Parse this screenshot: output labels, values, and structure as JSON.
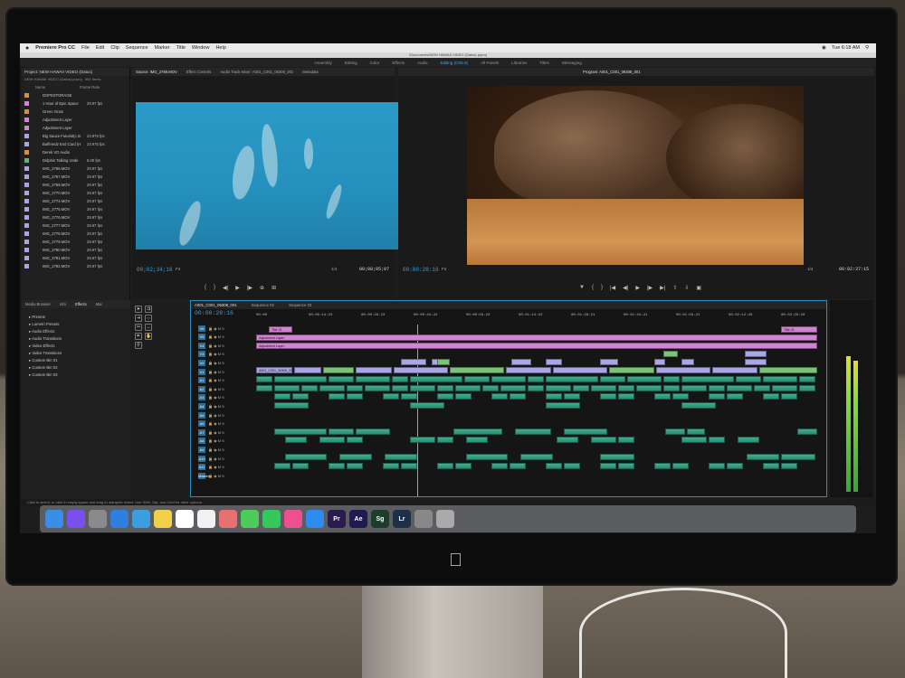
{
  "menubar": {
    "app_name": "Premiere Pro CC",
    "items": [
      "File",
      "Edit",
      "Clip",
      "Sequence",
      "Marker",
      "Title",
      "Window",
      "Help"
    ],
    "clock": "Tue 6:18 AM"
  },
  "window_title": "/Documents/NEW HAWAII VIDEO (Datus).prproj",
  "workspaces": [
    "Assembly",
    "Editing",
    "Color",
    "Effects",
    "Audio",
    "Editing (CS5.5)",
    "All Panels",
    "Libraries",
    "Titles",
    "Messaging"
  ],
  "workspaces_active": "Editing (CS5.5)",
  "project": {
    "tab": "Project: NEW HAWAII VIDEO (Datus)",
    "path": "NEW HAWAII VIDEO (Datus).prproj",
    "items_count": "563 Items",
    "col_name": "Name",
    "col_fps": "Frame Rate",
    "rows": [
      {
        "name": "DOPESTORAGE",
        "fps": "",
        "color": "#e08a3a"
      },
      {
        "name": "1 Hour of Epic Space",
        "fps": "29.97 fps",
        "color": "#d283d3"
      },
      {
        "name": "Green Grain",
        "fps": "",
        "color": "#e08a3a"
      },
      {
        "name": "Adjustment Layer",
        "fps": "",
        "color": "#d283d3"
      },
      {
        "name": "Adjustment Layer",
        "fps": "",
        "color": "#d283d3"
      },
      {
        "name": "Big Sauce Futurist(c.m",
        "fps": "23.976 fps",
        "color": "#a9a6e6"
      },
      {
        "name": "Bufferedz End Card (H",
        "fps": "23.976 fps",
        "color": "#a9a6e6"
      },
      {
        "name": "Derek VO Audio",
        "fps": "",
        "color": "#e08a3a"
      },
      {
        "name": "Dolphin Talking Unde",
        "fps": "6.00 fps",
        "color": "#5ab96c"
      },
      {
        "name": "IMG_2766.MOV",
        "fps": "29.97 fps",
        "color": "#a9a6e6"
      },
      {
        "name": "IMG_2767.MOV",
        "fps": "29.97 fps",
        "color": "#a9a6e6"
      },
      {
        "name": "IMG_2769.MOV",
        "fps": "29.97 fps",
        "color": "#a9a6e6"
      },
      {
        "name": "IMG_2770.MOV",
        "fps": "29.97 fps",
        "color": "#a9a6e6"
      },
      {
        "name": "IMG_2774.MOV",
        "fps": "29.97 fps",
        "color": "#a9a6e6"
      },
      {
        "name": "IMG_2775.MOV",
        "fps": "29.97 fps",
        "color": "#a9a6e6"
      },
      {
        "name": "IMG_2776.MOV",
        "fps": "29.97 fps",
        "color": "#a9a6e6"
      },
      {
        "name": "IMG_2777.MOV",
        "fps": "29.97 fps",
        "color": "#a9a6e6"
      },
      {
        "name": "IMG_2778.MOV",
        "fps": "29.97 fps",
        "color": "#a9a6e6"
      },
      {
        "name": "IMG_2779.MOV",
        "fps": "29.97 fps",
        "color": "#a9a6e6"
      },
      {
        "name": "IMG_2780.MOV",
        "fps": "29.97 fps",
        "color": "#a9a6e6"
      },
      {
        "name": "IMG_2781.MOV",
        "fps": "29.97 fps",
        "color": "#a9a6e6"
      },
      {
        "name": "IMG_2782.MOV",
        "fps": "29.97 fps",
        "color": "#a9a6e6"
      }
    ]
  },
  "source_monitor": {
    "tabs": [
      "Source: IMG_2769.MOV",
      "Effect Controls",
      "Audio Track Mixer: A001_C001_06308_001",
      "Metadata"
    ],
    "timecode": "00;02;34;16",
    "fit": "Fit",
    "scale": "1/4",
    "duration": "00;00;05;07"
  },
  "program_monitor": {
    "title": "Program: A001_C001_06308_001",
    "timecode": "00:00:28:16",
    "fit": "Fit",
    "scale": "1/4",
    "duration": "00:02:37:15"
  },
  "effects_panel": {
    "tabs": [
      "Media Browser",
      "Info",
      "Effects",
      "Mar"
    ],
    "items": [
      "Presets",
      "Lumetri Presets",
      "Audio Effects",
      "Audio Transitions",
      "Video Effects",
      "Video Transitions",
      "Custom Bin 01",
      "Custom Bin 02",
      "Custom Bin 03"
    ]
  },
  "timeline": {
    "tabs": [
      "A001_C001_06308_001",
      "Sequence 02",
      "Sequence 03"
    ],
    "timecode": "00:00:28:16",
    "ruler": [
      "00:00",
      "00:00:14:23",
      "00:00:29:23",
      "00:00:44:22",
      "00:00:59:22",
      "00:01:14:22",
      "00:01:29:21",
      "00:01:44:21",
      "00:01:59:21",
      "00:02:14:20",
      "00:02:29:20"
    ],
    "video_tracks": [
      "V6",
      "V5",
      "V4",
      "V3",
      "V2",
      "V1"
    ],
    "audio_tracks": [
      "A1",
      "A2",
      "A3",
      "A4",
      "A5",
      "A6",
      "A7",
      "A8",
      "A9",
      "A10",
      "A11"
    ],
    "master": "Master",
    "clip_title": "Title 01",
    "clip_adjust": "Adjustment Layer",
    "clip_v1": "A001_C001_06308_001"
  },
  "status_text": "Click to select, or click in empty space and drag to marquee select. Use Shift, Opt, and Cmd for other options.",
  "dock": [
    "Finder",
    "Siri",
    "Launchpad",
    "Safari",
    "Preview",
    "Notes",
    "Calendar",
    "Reminders",
    "Photos",
    "Messages",
    "FaceTime",
    "iTunes",
    "App Store",
    "Premiere Pro",
    "After Effects",
    "SpeedGrade",
    "Lightroom",
    "Settings",
    "Trash"
  ]
}
